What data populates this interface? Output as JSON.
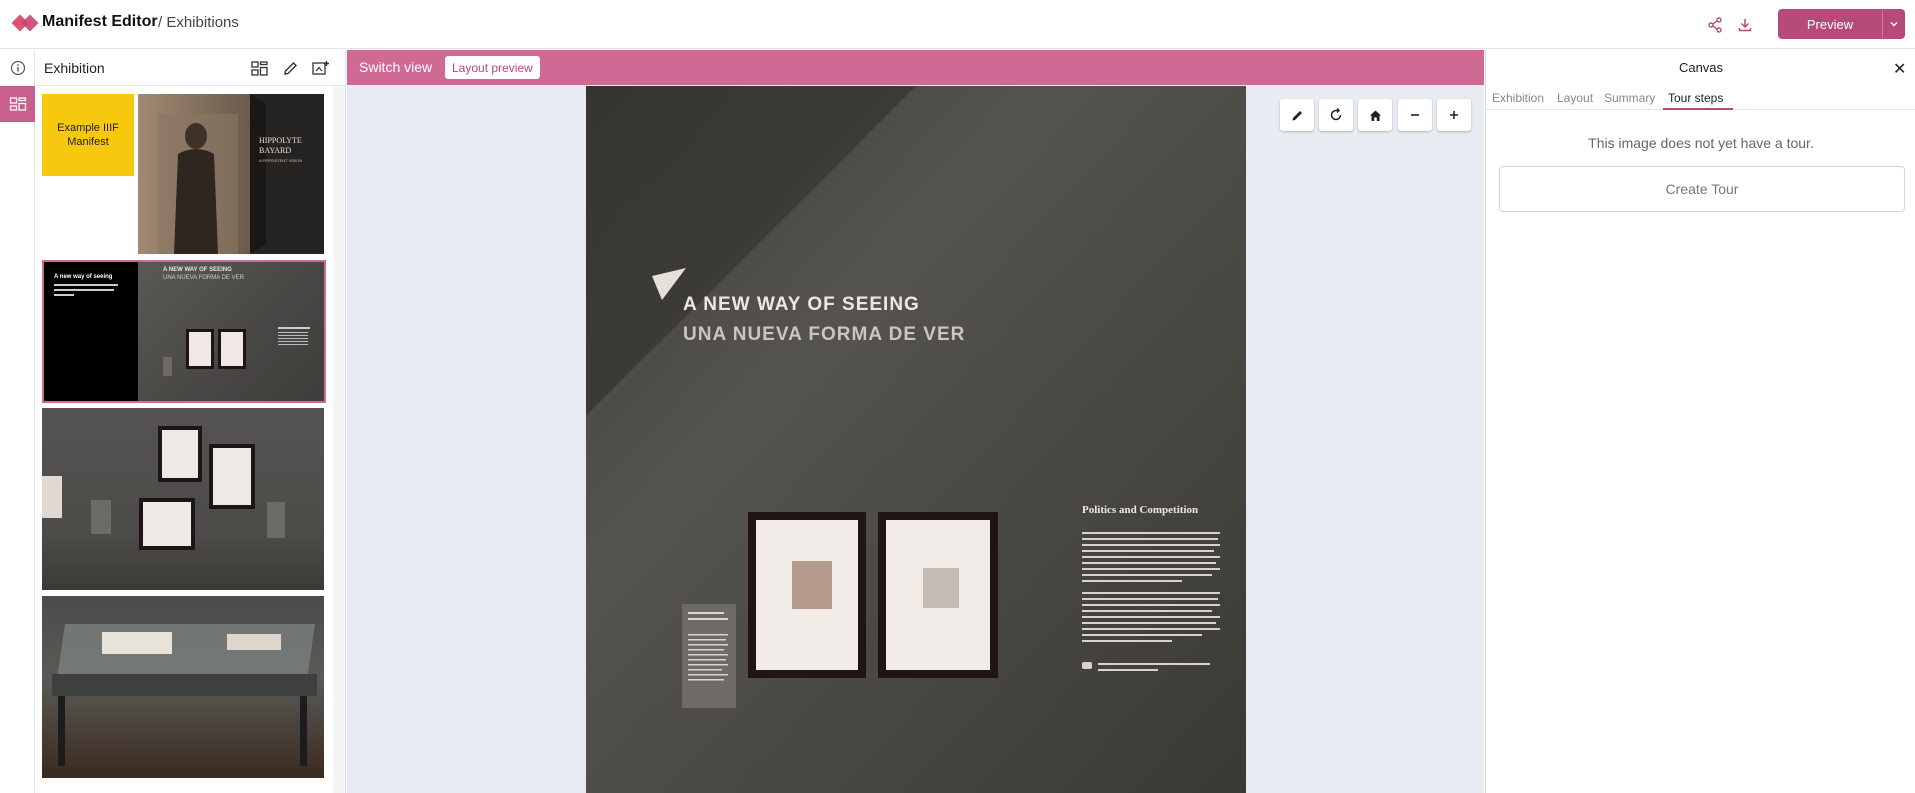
{
  "app": {
    "name": "Manifest Editor",
    "breadcrumb": "/ Exhibitions",
    "brand_color": "#b84a79",
    "preview_label": "Preview"
  },
  "left_panel": {
    "title": "Exhibition",
    "thumbnails": [
      {
        "label": "Example IIIF Manifest",
        "kind": "card",
        "color": "#f6c90e"
      },
      {
        "label": "HIPPOLYTE BAYARD",
        "subtitle": "A PERSISTENT VISION",
        "kind": "photo"
      },
      {
        "title": "A new way of seeing",
        "heading": "A NEW WAY OF SEEING",
        "heading2": "UNA NUEVA FORMA DE VER",
        "kind": "info-photo",
        "selected": true
      },
      {
        "kind": "photo"
      },
      {
        "kind": "photo"
      }
    ]
  },
  "center": {
    "switch_view": "Switch view",
    "layout_preview": "Layout preview",
    "image_title_1": "A NEW WAY OF SEEING",
    "image_title_2": "UNA NUEVA FORMA DE VER",
    "wall_panel_title": "Politics and Competition",
    "zoom_controls": [
      "pencil-icon",
      "rotate-icon",
      "home-icon",
      "zoom-out-icon",
      "zoom-in-icon"
    ]
  },
  "right_panel": {
    "title": "Canvas",
    "tabs": [
      {
        "label": "Exhibition",
        "active": false
      },
      {
        "label": "Layout",
        "active": false
      },
      {
        "label": "Summary",
        "active": false
      },
      {
        "label": "Tour steps",
        "active": true
      }
    ],
    "empty_message": "This image does not yet have a tour.",
    "create_tour_label": "Create Tour"
  }
}
